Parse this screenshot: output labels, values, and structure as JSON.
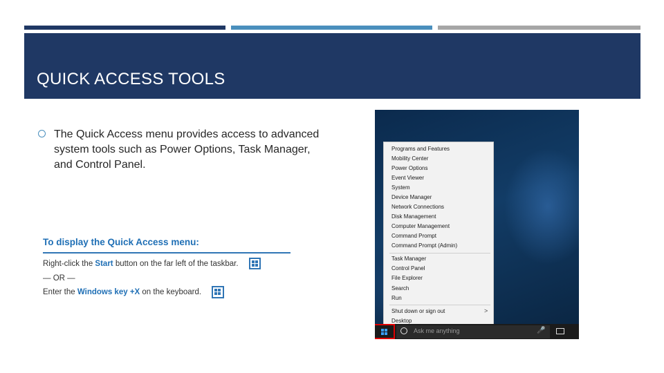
{
  "slide": {
    "title": "QUICK ACCESS TOOLS",
    "bullet": "The Quick Access menu provides access to advanced system tools such as Power Options, Task Manager, and Control Panel."
  },
  "howto": {
    "heading": "To display the Quick Access menu:",
    "line1_pre": "Right-click the ",
    "line1_bold": "Start",
    "line1_post": " button on the far left of the taskbar.",
    "or_text": "— OR —",
    "line2_pre": "Enter the ",
    "line2_bold": "Windows key +X",
    "line2_post": " on the keyboard."
  },
  "screenshot": {
    "menu_items": [
      "Programs and Features",
      "Mobility Center",
      "Power Options",
      "Event Viewer",
      "System",
      "Device Manager",
      "Network Connections",
      "Disk Management",
      "Computer Management",
      "Command Prompt",
      "Command Prompt (Admin)",
      "Task Manager",
      "Control Panel",
      "File Explorer",
      "Search",
      "Run",
      "Shut down or sign out",
      "Desktop"
    ],
    "submenu_arrow": ">",
    "search_placeholder": "Ask me anything"
  },
  "colors": {
    "header_bg": "#1f3864",
    "accent_blue": "#4a8fbd",
    "accent_gray": "#a6a6a6",
    "highlight_red": "#e00000"
  },
  "icons": [
    "windows-logo-icon",
    "cortana-icon",
    "microphone-icon",
    "task-view-icon",
    "chevron-right-icon",
    "bullet-circle-icon"
  ]
}
